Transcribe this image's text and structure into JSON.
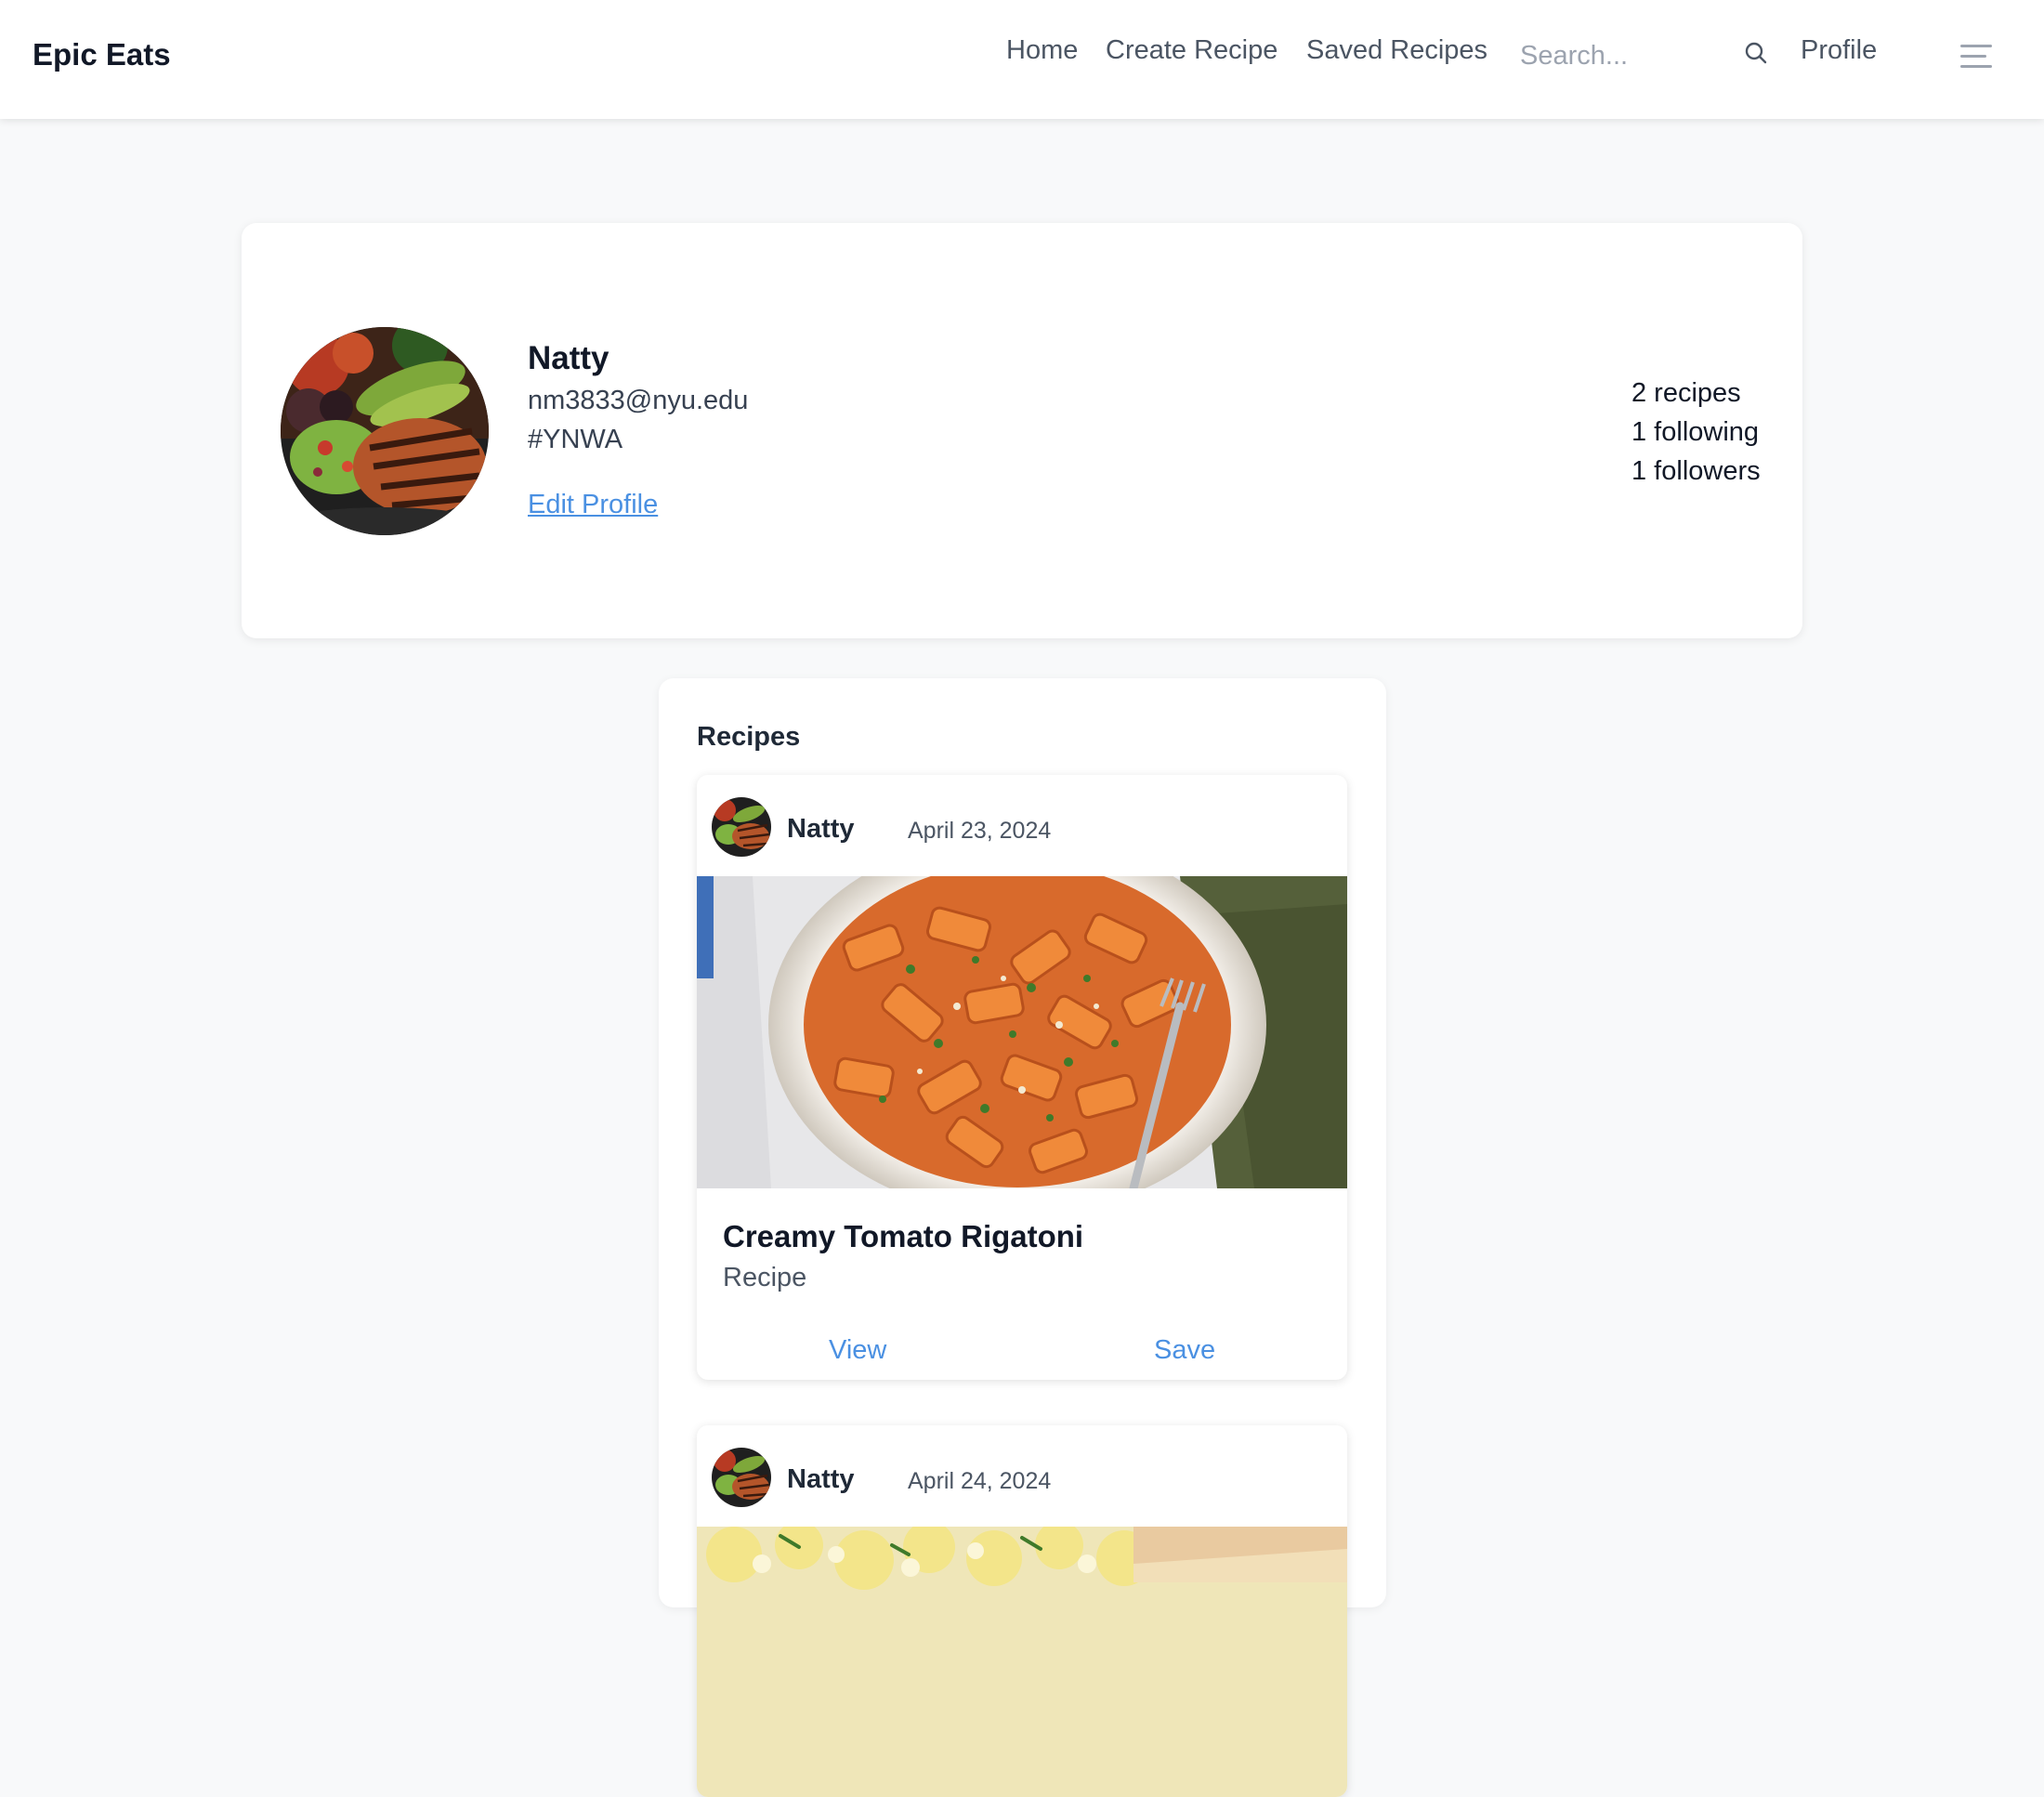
{
  "app": {
    "brand": "Epic Eats"
  },
  "nav": {
    "home": "Home",
    "create_recipe": "Create Recipe",
    "saved_recipes": "Saved Recipes",
    "search_placeholder": "Search...",
    "profile": "Profile",
    "search_icon": "search-icon",
    "menu_icon": "menu-icon"
  },
  "profile": {
    "name": "Natty",
    "email": "nm3833@nyu.edu",
    "bio": "#YNWA",
    "edit_label": "Edit Profile",
    "stats": {
      "recipes": "2 recipes",
      "following": "1 following",
      "followers": "1 followers"
    }
  },
  "recipes": {
    "heading": "Recipes",
    "items": [
      {
        "author": "Natty",
        "date": "April 23, 2024",
        "title": "Creamy Tomato Rigatoni",
        "subtitle": "Recipe",
        "view_label": "View",
        "save_label": "Save"
      },
      {
        "author": "Natty",
        "date": "April 24, 2024"
      }
    ]
  },
  "colors": {
    "accent": "#4a90e2",
    "background": "#f8f9fa",
    "card": "#ffffff",
    "text": "#111827",
    "muted": "#4b5563"
  }
}
